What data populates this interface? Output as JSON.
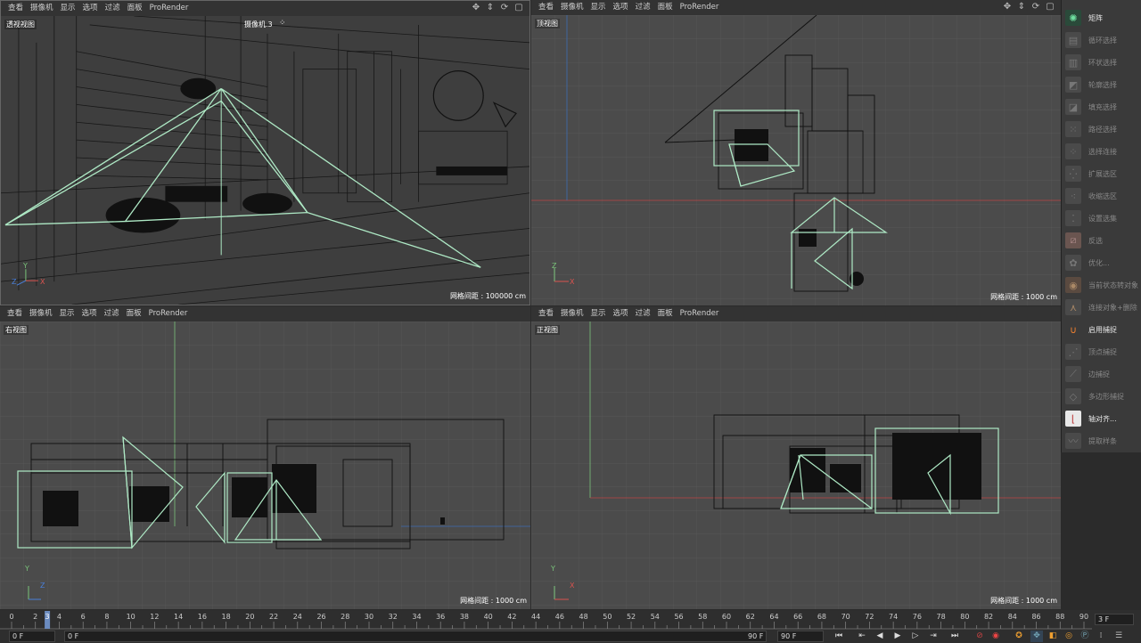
{
  "menu": [
    "查看",
    "摄像机",
    "显示",
    "选项",
    "过滤",
    "面板",
    "ProRender"
  ],
  "viewports": {
    "persp": {
      "name": "透视视图",
      "camera": "摄像机.3",
      "grid": "网格间距 : 100000 cm"
    },
    "top": {
      "name": "顶视图",
      "grid": "网格间距 : 1000 cm"
    },
    "right": {
      "name": "右视图",
      "grid": "网格间距 : 1000 cm"
    },
    "front": {
      "name": "正视图",
      "grid": "网格间距 : 1000 cm"
    }
  },
  "axes": {
    "x": "X",
    "y": "Y",
    "z": "Z"
  },
  "sidebar": [
    {
      "label": "矩阵",
      "icon": "matrix-icon",
      "active": true
    },
    {
      "label": "循环选择",
      "icon": "loop-selection-icon",
      "active": false
    },
    {
      "label": "环状选择",
      "icon": "ring-selection-icon",
      "active": false
    },
    {
      "label": "轮廓选择",
      "icon": "outline-selection-icon",
      "active": false
    },
    {
      "label": "填充选择",
      "icon": "fill-selection-icon",
      "active": false
    },
    {
      "label": "路径选择",
      "icon": "path-selection-icon",
      "active": false
    },
    {
      "label": "选择连接",
      "icon": "select-connected-icon",
      "active": false
    },
    {
      "label": "扩展选区",
      "icon": "grow-selection-icon",
      "active": false
    },
    {
      "label": "收缩选区",
      "icon": "shrink-selection-icon",
      "active": false
    },
    {
      "label": "设置选集",
      "icon": "set-selection-icon",
      "active": false
    },
    {
      "label": "反选",
      "icon": "invert-selection-icon",
      "active": false
    },
    {
      "label": "优化...",
      "icon": "optimize-icon",
      "active": false
    },
    {
      "label": "当前状态转对象",
      "icon": "current-state-to-object-icon",
      "active": false
    },
    {
      "label": "连接对象+删除",
      "icon": "connect-delete-icon",
      "active": false
    },
    {
      "label": "启用捕捉",
      "icon": "snap-magnet-icon",
      "active": true
    },
    {
      "label": "顶点捕捉",
      "icon": "vertex-snap-icon",
      "active": false
    },
    {
      "label": "边捕捉",
      "icon": "edge-snap-icon",
      "active": false
    },
    {
      "label": "多边形捕捉",
      "icon": "polygon-snap-icon",
      "active": false
    },
    {
      "label": "轴对齐...",
      "icon": "axis-align-icon",
      "active": true
    },
    {
      "label": "提取样条",
      "icon": "extract-spline-icon",
      "active": false
    }
  ],
  "timeline": {
    "ticks": [
      0,
      2,
      4,
      6,
      8,
      10,
      12,
      14,
      16,
      18,
      20,
      22,
      24,
      26,
      28,
      30,
      32,
      34,
      36,
      38,
      40,
      42,
      44,
      46,
      48,
      50,
      52,
      54,
      56,
      58,
      60,
      62,
      64,
      66,
      68,
      70,
      72,
      74,
      76,
      78,
      80,
      82,
      84,
      86,
      88,
      90
    ],
    "current_frame_marker": "3",
    "end_label": "3 F",
    "start_field": "0 F",
    "min_field": "0 F",
    "max_field": "90 F",
    "end_field": "90 F"
  }
}
